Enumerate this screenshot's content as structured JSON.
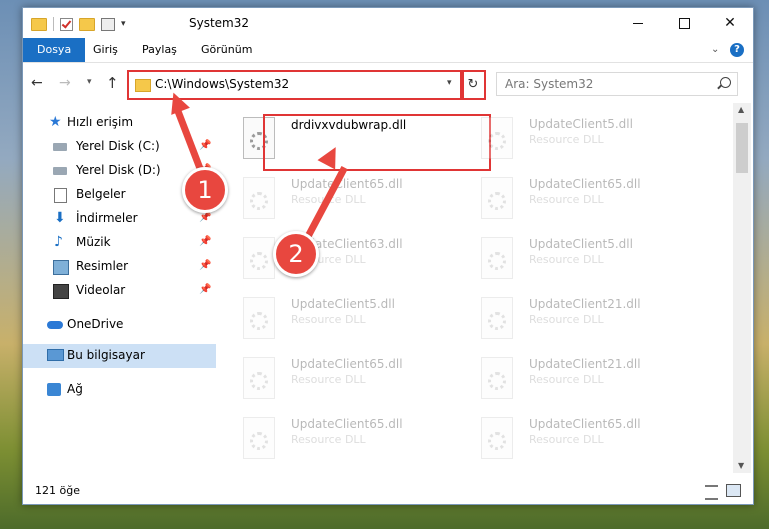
{
  "window": {
    "title": "System32"
  },
  "ribbon": {
    "tabs": [
      "Dosya",
      "Giriş",
      "Paylaş",
      "Görünüm"
    ],
    "help": "?"
  },
  "address": {
    "path": "C:\\Windows\\System32",
    "search_placeholder": "Ara: System32"
  },
  "sidebar": {
    "items": [
      {
        "label": "Hızlı erişim",
        "icon": "star-icon"
      },
      {
        "label": "Yerel Disk (C:)",
        "icon": "disk-icon"
      },
      {
        "label": "Yerel Disk (D:)",
        "icon": "disk-icon"
      },
      {
        "label": "Belgeler",
        "icon": "documents-icon"
      },
      {
        "label": "İndirmeler",
        "icon": "downloads-icon"
      },
      {
        "label": "Müzik",
        "icon": "music-icon"
      },
      {
        "label": "Resimler",
        "icon": "pictures-icon"
      },
      {
        "label": "Videolar",
        "icon": "videos-icon"
      },
      {
        "label": "OneDrive",
        "icon": "cloud-icon"
      },
      {
        "label": "Bu bilgisayar",
        "icon": "computer-icon"
      },
      {
        "label": "Ağ",
        "icon": "network-icon"
      }
    ]
  },
  "files": {
    "highlighted": {
      "name": "drdivxvdubwrap.dll"
    },
    "type_label": "Resource DLL",
    "left_col": [
      "UpdateClient65.dll",
      "UpdateClient63.dll",
      "UpdateClient5.dll",
      "UpdateClient65.dll",
      "UpdateClient65.dll"
    ],
    "right_col": [
      "UpdateClient5.dll",
      "UpdateClient65.dll",
      "UpdateClient5.dll",
      "UpdateClient21.dll",
      "UpdateClient21.dll",
      "UpdateClient65.dll"
    ]
  },
  "status": {
    "count": "121 öğe"
  },
  "callouts": {
    "one": "1",
    "two": "2",
    "color": "#e8473f"
  }
}
